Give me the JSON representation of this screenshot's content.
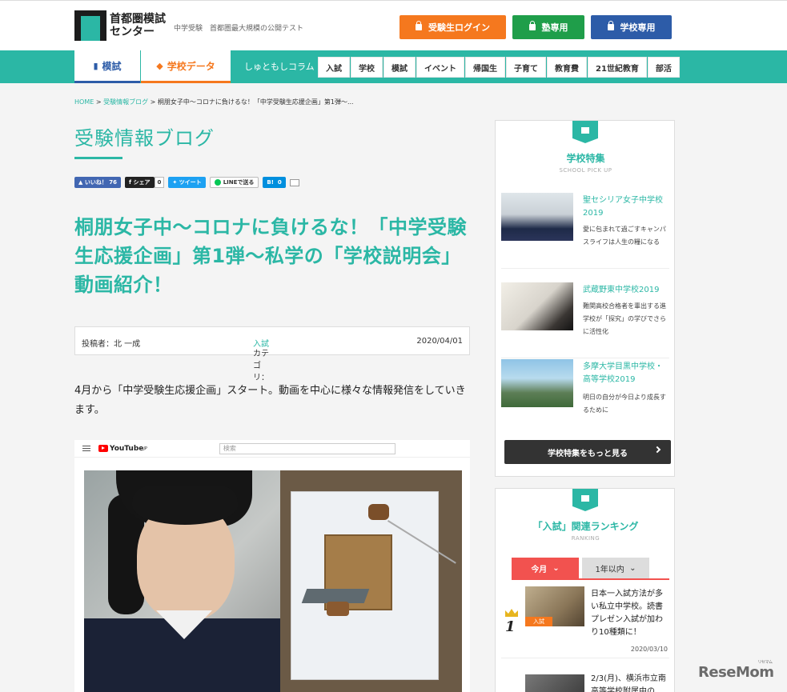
{
  "header": {
    "logo_text": "首都圏模試センター",
    "tagline": "中学受験　首都圏最大規模の公開テスト",
    "login_student": "受験生ログイン",
    "login_juku": "塾専用",
    "login_school": "学校専用",
    "colors": {
      "teal": "#2bb7a5",
      "orange": "#f5781e",
      "green": "#1f9e4a",
      "blue": "#2d5ca8"
    }
  },
  "nav": {
    "tab_mock": "模試",
    "tab_school": "学校データ",
    "column": "しゅともしコラム",
    "categories": [
      "入試",
      "学校",
      "模試",
      "イベント",
      "帰国生",
      "子育て",
      "教育費",
      "21世紀教育",
      "部活"
    ]
  },
  "breadcrumb": {
    "home": "HOME",
    "sep": ">",
    "blog": "受験情報ブログ",
    "current": "桐朋女子中～コロナに負けるな！「中学受験生応援企画」第1弾～..."
  },
  "blog_title": "受験情報ブログ",
  "social": {
    "like": "いいね！",
    "like_count": "76",
    "share": "シェア",
    "share_count": "0",
    "tweet": "ツイート",
    "line": "LINEで送る",
    "hatena": "B!",
    "hatena_count": "0"
  },
  "article": {
    "title": "桐朋女子中～コロナに負けるな！「中学受験生応援企画」第1弾～私学の「学校説明会」動画紹介！",
    "author_label": "投稿者：北 一成",
    "category_label": "カテゴリ：",
    "category": "入試",
    "date": "2020/04/01",
    "lead": "4月から「中学受験生応援企画」スタート。動画を中心に様々な情報発信をしていきます。"
  },
  "video": {
    "logo": "YouTube",
    "logo_sup": "JP",
    "search_placeholder": "検索"
  },
  "sidebar": {
    "pickup_title": "学校特集",
    "pickup_sub": "SCHOOL PICK UP",
    "pickups": [
      {
        "name": "聖セシリア女子中学校2019",
        "desc": "愛に包まれて過ごすキャンパスライフは人生の糧になる"
      },
      {
        "name": "武蔵野東中学校2019",
        "desc": "難関高校合格者を輩出する進学校が「探究」の学びでさらに活性化"
      },
      {
        "name": "多摩大学目黒中学校・高等学校2019",
        "desc": "明日の自分が今日より成長するために"
      }
    ],
    "more": "学校特集をもっと見る",
    "ranking_title": "「入試」関連ランキング",
    "ranking_sub": "RANKING",
    "tab_today": "今月",
    "tab_year": "1年以内",
    "rank1": {
      "num": "1",
      "tag": "入試",
      "text": "日本一入試方法が多い私立中学校。読書プレゼン入試が加わり10種類に！",
      "date": "2020/03/10"
    },
    "rank2": {
      "text": "2/3(月)、横浜市立南高等学校附属中の..."
    }
  },
  "watermark": "ReseMom",
  "watermark_small": "リセマム"
}
